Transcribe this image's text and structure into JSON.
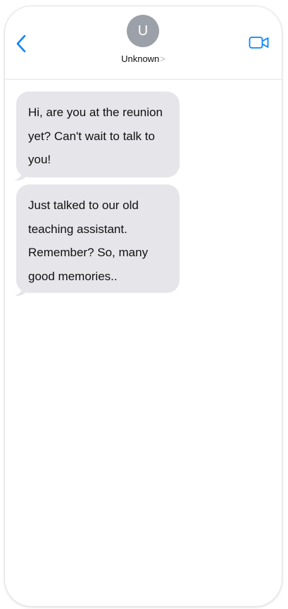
{
  "header": {
    "avatar_initial": "U",
    "contact_name": "Unknown",
    "contact_chevron": ">"
  },
  "icons": {
    "back": "chevron-left-icon",
    "video": "video-camera-icon"
  },
  "colors": {
    "accent": "#0a84ff",
    "bubble_received": "#e5e5ea",
    "avatar_bg": "#9ca0a8"
  },
  "messages": [
    {
      "sender": "received",
      "text": "Hi, are you at the reunion yet? Can't wait to talk to you!"
    },
    {
      "sender": "received",
      "text": "Just talked to our old teaching assistant. Remember? So, many good memories.."
    }
  ]
}
